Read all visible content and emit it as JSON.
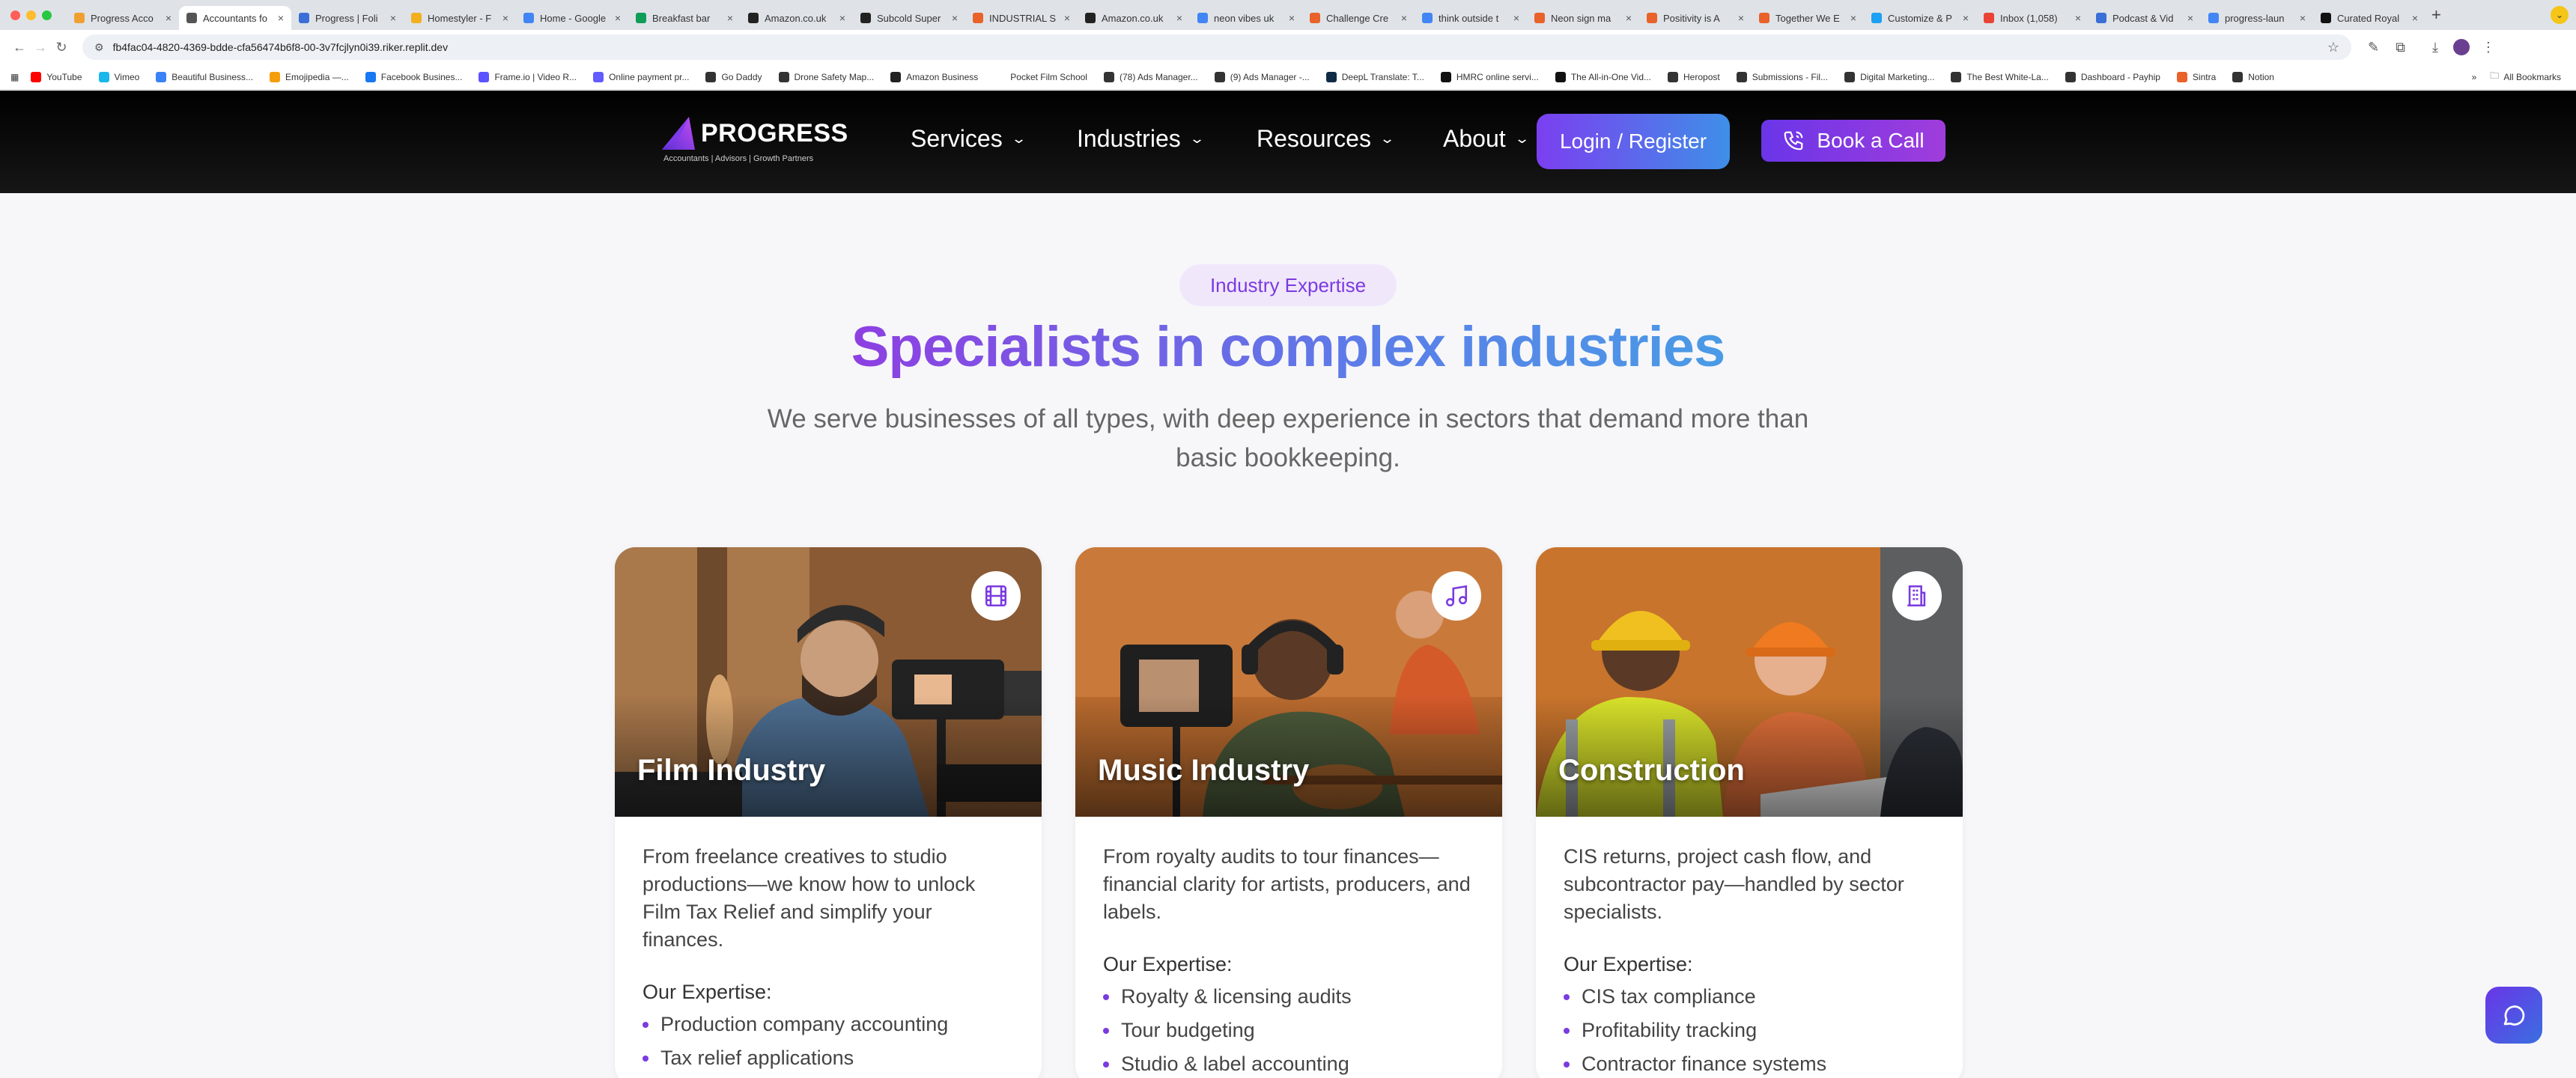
{
  "browser": {
    "tabs": [
      {
        "title": "Progress Acco",
        "color": "#f0a030"
      },
      {
        "title": "Accountants fo",
        "color": "#555555",
        "active": true
      },
      {
        "title": "Progress | Foli",
        "color": "#3b6fd8"
      },
      {
        "title": "Homestyler - F",
        "color": "#f2b01e"
      },
      {
        "title": "Home - Google",
        "color": "#4285f4"
      },
      {
        "title": "Breakfast bar",
        "color": "#0f9d58"
      },
      {
        "title": "Amazon.co.uk",
        "color": "#222222"
      },
      {
        "title": "Subcold Super",
        "color": "#222222"
      },
      {
        "title": "INDUSTRIAL S",
        "color": "#e8622a"
      },
      {
        "title": "Amazon.co.uk",
        "color": "#222222"
      },
      {
        "title": "neon vibes uk",
        "color": "#4285f4"
      },
      {
        "title": "Challenge Cre",
        "color": "#e8622a"
      },
      {
        "title": "think outside t",
        "color": "#4285f4"
      },
      {
        "title": "Neon sign ma",
        "color": "#e8622a"
      },
      {
        "title": "Positivity is A",
        "color": "#e8622a"
      },
      {
        "title": "Together We E",
        "color": "#e8622a"
      },
      {
        "title": "Customize & P",
        "color": "#1da1f2"
      },
      {
        "title": "Inbox (1,058)",
        "color": "#ea4335"
      },
      {
        "title": "Podcast & Vid",
        "color": "#3b6fd8"
      },
      {
        "title": "progress-laun",
        "color": "#4285f4"
      },
      {
        "title": "Curated Royal",
        "color": "#111111"
      }
    ],
    "url": "fb4fac04-4820-4369-bdde-cfa56474b6f8-00-3v7fcjlyn0i39.riker.replit.dev",
    "bookmarks": [
      {
        "label": "YouTube",
        "color": "#ff0000"
      },
      {
        "label": "Vimeo",
        "color": "#1ab7ea"
      },
      {
        "label": "Beautiful Business...",
        "color": "#3b82f6"
      },
      {
        "label": "Emojipedia —...",
        "color": "#f59e0b"
      },
      {
        "label": "Facebook Busines...",
        "color": "#1877f2"
      },
      {
        "label": "Frame.io | Video R...",
        "color": "#5b53ff"
      },
      {
        "label": "Online payment pr...",
        "color": "#635bff"
      },
      {
        "label": "Go Daddy",
        "color": "#333333"
      },
      {
        "label": "Drone Safety Map...",
        "color": "#333333"
      },
      {
        "label": "Amazon Business",
        "color": "#222222"
      },
      {
        "label": "Pocket Film School",
        "color": "#ffffff"
      },
      {
        "label": "(78) Ads Manager...",
        "color": "#333333"
      },
      {
        "label": "(9) Ads Manager -...",
        "color": "#333333"
      },
      {
        "label": "DeepL Translate: T...",
        "color": "#0f2b46"
      },
      {
        "label": "HMRC online servi...",
        "color": "#111111"
      },
      {
        "label": "The All-in-One Vid...",
        "color": "#111111"
      },
      {
        "label": "Heropost",
        "color": "#333333"
      },
      {
        "label": "Submissions - Fil...",
        "color": "#333333"
      },
      {
        "label": "Digital Marketing...",
        "color": "#333333"
      },
      {
        "label": "The Best White-La...",
        "color": "#333333"
      },
      {
        "label": "Dashboard - Payhip",
        "color": "#333333"
      },
      {
        "label": "Sintra",
        "color": "#e8622a"
      },
      {
        "label": "Notion",
        "color": "#333333"
      }
    ],
    "all_bookmarks": "All Bookmarks"
  },
  "site": {
    "logo": {
      "word": "PROGRESS",
      "tagline": "Accountants | Advisors | Growth Partners"
    },
    "nav": {
      "services": "Services",
      "industries": "Industries",
      "resources": "Resources",
      "about": "About",
      "login": "Login / Register",
      "book": "Book a Call"
    },
    "hero": {
      "badge": "Industry Expertise",
      "headline": "Specialists in complex industries",
      "sub": "We serve businesses of all types, with deep experience in sectors that demand more than basic bookkeeping."
    },
    "cards": [
      {
        "title": "Film Industry",
        "icon": "film-icon",
        "desc": "From freelance creatives to studio productions—we know how to unlock Film Tax Relief and simplify your finances.",
        "expertise_label": "Our Expertise:",
        "items": [
          "Production company accounting",
          "Tax relief applications"
        ]
      },
      {
        "title": "Music Industry",
        "icon": "music-note-icon",
        "desc": "From royalty audits to tour finances—financial clarity for artists, producers, and labels.",
        "expertise_label": "Our Expertise:",
        "items": [
          "Royalty & licensing audits",
          "Tour budgeting",
          "Studio & label accounting"
        ]
      },
      {
        "title": "Construction",
        "icon": "building-icon",
        "desc": "CIS returns, project cash flow, and subcontractor pay—handled by sector specialists.",
        "expertise_label": "Our Expertise:",
        "items": [
          "CIS tax compliance",
          "Profitability tracking",
          "Contractor finance systems"
        ]
      }
    ]
  }
}
